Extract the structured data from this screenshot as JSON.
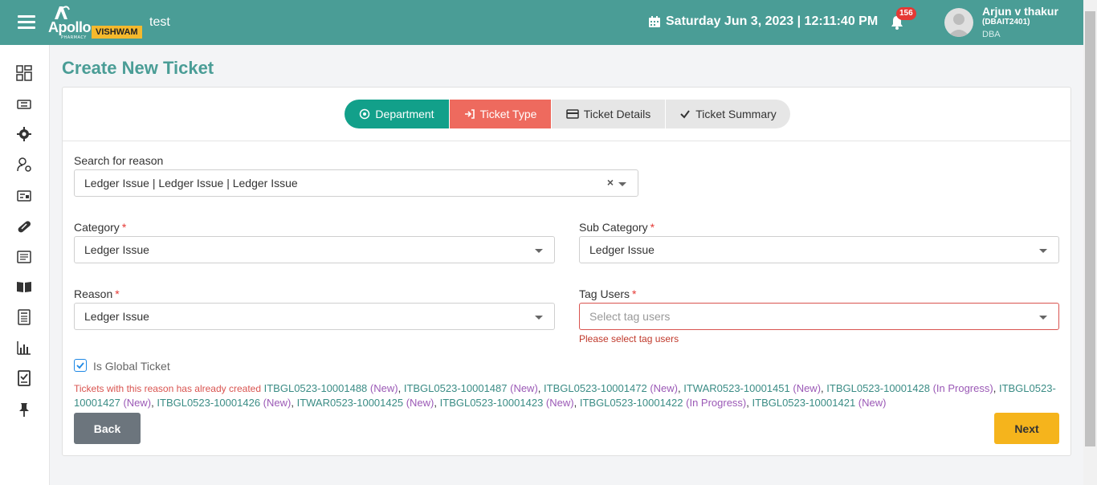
{
  "header": {
    "logo_brand": "Apollo",
    "logo_sub": "PHARMACY",
    "logo_tag": "VISHWAM",
    "app_name": "test",
    "datetime": "Saturday Jun 3, 2023 | 12:11:40   PM",
    "notification_count": "156",
    "user": {
      "name": "Arjun v thakur",
      "id": "(DBAIT2401)",
      "role": "DBA"
    }
  },
  "sidebar": {
    "items": [
      {
        "icon": "dashboard-icon"
      },
      {
        "icon": "ticket-icon"
      },
      {
        "icon": "gear-icon"
      },
      {
        "icon": "user-settings-icon"
      },
      {
        "icon": "id-card-icon"
      },
      {
        "icon": "pill-icon"
      },
      {
        "icon": "document-list-icon"
      },
      {
        "icon": "book-icon"
      },
      {
        "icon": "calculator-icon"
      },
      {
        "icon": "bar-chart-icon"
      },
      {
        "icon": "checklist-icon"
      },
      {
        "icon": "pin-icon"
      }
    ]
  },
  "page": {
    "title": "Create New Ticket"
  },
  "steps": [
    {
      "label": "Department",
      "icon": "department-icon"
    },
    {
      "label": "Ticket Type",
      "icon": "sign-in-icon"
    },
    {
      "label": "Ticket Details",
      "icon": "credit-card-icon"
    },
    {
      "label": "Ticket Summary",
      "icon": "check-icon"
    }
  ],
  "form": {
    "search": {
      "label": "Search for reason",
      "value": "Ledger Issue | Ledger Issue | Ledger Issue",
      "clear": "×"
    },
    "category": {
      "label": "Category",
      "required": "*",
      "value": "Ledger Issue"
    },
    "sub_category": {
      "label": "Sub Category",
      "required": "*",
      "value": "Ledger Issue"
    },
    "reason": {
      "label": "Reason",
      "required": "*",
      "value": "Ledger Issue"
    },
    "tag_users": {
      "label": "Tag Users",
      "required": "*",
      "placeholder": "Select tag users",
      "error": "Please select tag users"
    },
    "global_ticket": {
      "label": "Is Global Ticket",
      "checked": true
    }
  },
  "existing_tickets": {
    "lead": "Tickets with this reason has already created",
    "items": [
      {
        "id": "ITBGL0523-10001488",
        "status": "(New)"
      },
      {
        "id": "ITBGL0523-10001487",
        "status": "(New)"
      },
      {
        "id": "ITBGL0523-10001472",
        "status": "(New)"
      },
      {
        "id": "ITWAR0523-10001451",
        "status": "(New)"
      },
      {
        "id": "ITBGL0523-10001428",
        "status": "(In Progress)"
      },
      {
        "id": "ITBGL0523-10001427",
        "status": "(New)"
      },
      {
        "id": "ITBGL0523-10001426",
        "status": "(New)"
      },
      {
        "id": "ITWAR0523-10001425",
        "status": "(New)"
      },
      {
        "id": "ITBGL0523-10001423",
        "status": "(New)"
      },
      {
        "id": "ITBGL0523-10001422",
        "status": "(In Progress)"
      },
      {
        "id": "ITBGL0523-10001421",
        "status": "(New)"
      }
    ]
  },
  "buttons": {
    "back": "Back",
    "next": "Next"
  },
  "colors": {
    "header": "#4a9d96",
    "step_active": "#12a08a",
    "step_current": "#ee6a5e",
    "next_button": "#f5b41c",
    "error": "#d9534f"
  }
}
